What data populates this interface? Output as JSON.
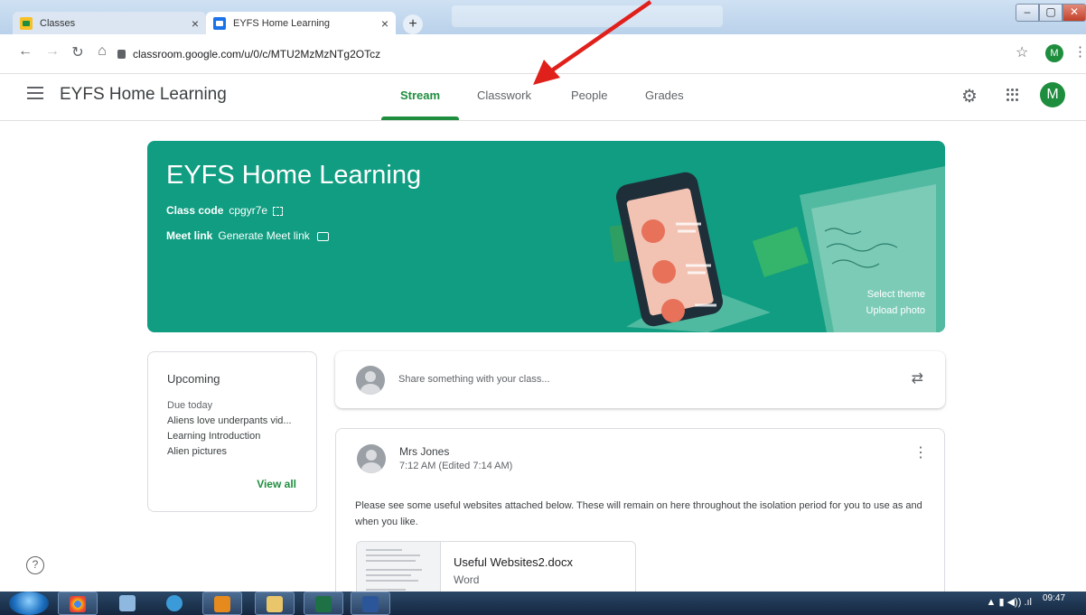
{
  "browser": {
    "tabs": [
      {
        "label": "Classes",
        "close": "×"
      },
      {
        "label": "EYFS Home Learning",
        "close": "×"
      }
    ],
    "new_tab": "+",
    "url": "classroom.google.com/u/0/c/MTU2MzMzNTg2OTcz",
    "profile_initial": "M",
    "window_controls": {
      "minimize": "–",
      "maximize": "▢",
      "close": "✕"
    }
  },
  "header": {
    "title": "EYFS Home Learning",
    "tabs": [
      {
        "label": "Stream",
        "active": true
      },
      {
        "label": "Classwork",
        "active": false
      },
      {
        "label": "People",
        "active": false
      },
      {
        "label": "Grades",
        "active": false
      }
    ],
    "profile_initial": "M"
  },
  "banner": {
    "title": "EYFS Home Learning",
    "class_code_label": "Class code",
    "class_code": "cpgyr7e",
    "meet_label": "Meet link",
    "meet_action": "Generate Meet link",
    "select_theme": "Select theme",
    "upload_photo": "Upload photo",
    "color": "#109d81"
  },
  "upcoming": {
    "title": "Upcoming",
    "due": "Due today",
    "items": [
      "Aliens love underpants vid...",
      "Learning Introduction",
      "Alien pictures"
    ],
    "view_all": "View all"
  },
  "share": {
    "placeholder": "Share something with your class..."
  },
  "post": {
    "author": "Mrs Jones",
    "time": "7:12 AM (Edited 7:14 AM)",
    "body": "Please see some useful websites attached below. These will remain on here throughout the isolation period for you to use as and when you like.",
    "attachment": {
      "name": "Useful Websites2.docx",
      "type": "Word"
    }
  },
  "taskbar": {
    "clock": "09:47"
  },
  "colors": {
    "accent": "#1e8e3e",
    "banner": "#109d81",
    "annotation_arrow": "#e0201b"
  }
}
